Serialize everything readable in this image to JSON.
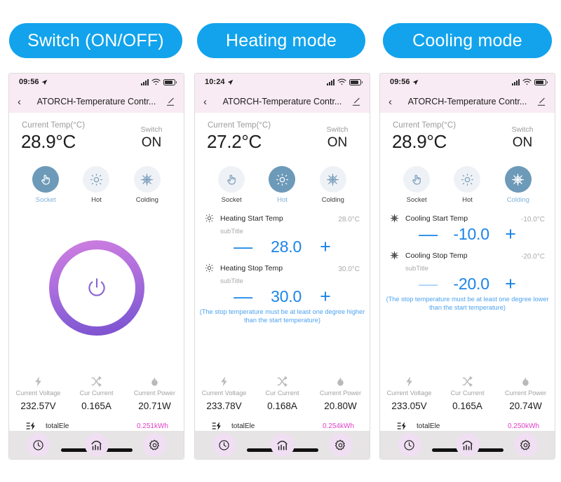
{
  "banners": [
    {
      "label": "Switch (ON/OFF)"
    },
    {
      "label": "Heating mode"
    },
    {
      "label": "Cooling mode"
    }
  ],
  "colors": {
    "banner_blue": "#12a3ec",
    "header_pink": "#f9ebf3",
    "accent_blue": "#1a84e8",
    "hint_blue": "#4da2ef",
    "total_magenta": "#e040c8",
    "mode_active": "#6d9ab8",
    "mode_inactive": "#eef2f6",
    "tabbar_bg": "#e6e4e4",
    "tab_circle": "#f0dff2"
  },
  "panels": [
    {
      "status": {
        "time": "09:56",
        "signal_icon": "signal-bars-icon",
        "wifi_icon": "wifi-icon",
        "battery_icon": "battery-icon"
      },
      "nav": {
        "back_icon": "back-chevron-icon",
        "title": "ATORCH-Temperature Contr...",
        "edit_icon": "edit-pencil-icon"
      },
      "temp": {
        "label": "Current Temp(°C)",
        "value": "28.9°C"
      },
      "switch": {
        "label": "Switch",
        "value": "ON"
      },
      "modes": [
        {
          "label": "Socket",
          "icon": "hand-tap-icon",
          "active": true
        },
        {
          "label": "Hot",
          "icon": "sun-icon",
          "active": false
        },
        {
          "label": "Colding",
          "icon": "snowflake-icon",
          "active": false
        }
      ],
      "view": "power",
      "power": {
        "icon": "power-button-icon"
      },
      "metrics": [
        {
          "icon": "lightning-bolt-icon",
          "label": "Current Voltage",
          "value": "232.57V"
        },
        {
          "icon": "shuffle-arrows-icon",
          "label": "Cur Current",
          "value": "0.165A"
        },
        {
          "icon": "flame-icon",
          "label": "Current Power",
          "value": "20.71W"
        }
      ],
      "total": {
        "icon": "energy-meter-icon",
        "label": "totalEle",
        "value": "0.251kWh"
      },
      "tabs": [
        {
          "icon": "clock-icon",
          "name": "history-tab"
        },
        {
          "icon": "bar-chart-icon",
          "name": "statistics-tab"
        },
        {
          "icon": "gear-icon",
          "name": "settings-tab"
        }
      ]
    },
    {
      "status": {
        "time": "10:24",
        "signal_icon": "signal-bars-icon",
        "wifi_icon": "wifi-icon",
        "battery_icon": "battery-icon"
      },
      "nav": {
        "back_icon": "back-chevron-icon",
        "title": "ATORCH-Temperature Contr...",
        "edit_icon": "edit-pencil-icon"
      },
      "temp": {
        "label": "Current Temp(°C)",
        "value": "27.2°C"
      },
      "switch": {
        "label": "Switch",
        "value": "ON"
      },
      "modes": [
        {
          "label": "Socket",
          "icon": "hand-tap-icon",
          "active": false
        },
        {
          "label": "Hot",
          "icon": "sun-icon",
          "active": true
        },
        {
          "label": "Colding",
          "icon": "snowflake-icon",
          "active": false
        }
      ],
      "view": "settings",
      "settings": [
        {
          "icon": "sun-icon",
          "title": "Heating Start Temp",
          "subtitle": "subTitle",
          "right_value": "28.0°C",
          "minus_label": "—",
          "minus_disabled": false,
          "value": "28.0",
          "plus_label": "+"
        },
        {
          "icon": "sun-icon",
          "title": "Heating Stop Temp",
          "subtitle": "subTitle",
          "right_value": "30.0°C",
          "minus_label": "—",
          "minus_disabled": false,
          "value": "30.0",
          "plus_label": "+"
        }
      ],
      "hint": "(The stop temperature must be at least one degree higher than the start temperature)",
      "metrics": [
        {
          "icon": "lightning-bolt-icon",
          "label": "Current Voltage",
          "value": "233.78V"
        },
        {
          "icon": "shuffle-arrows-icon",
          "label": "Cur Current",
          "value": "0.168A"
        },
        {
          "icon": "flame-icon",
          "label": "Current Power",
          "value": "20.80W"
        }
      ],
      "total": {
        "icon": "energy-meter-icon",
        "label": "totalEle",
        "value": "0.254kWh"
      },
      "tabs": [
        {
          "icon": "clock-icon",
          "name": "history-tab"
        },
        {
          "icon": "bar-chart-icon",
          "name": "statistics-tab"
        },
        {
          "icon": "gear-icon",
          "name": "settings-tab"
        }
      ]
    },
    {
      "status": {
        "time": "09:56",
        "signal_icon": "signal-bars-icon",
        "wifi_icon": "wifi-icon",
        "battery_icon": "battery-icon"
      },
      "nav": {
        "back_icon": "back-chevron-icon",
        "title": "ATORCH-Temperature Contr...",
        "edit_icon": "edit-pencil-icon"
      },
      "temp": {
        "label": "Current Temp(°C)",
        "value": "28.9°C"
      },
      "switch": {
        "label": "Switch",
        "value": "ON"
      },
      "modes": [
        {
          "label": "Socket",
          "icon": "hand-tap-icon",
          "active": false
        },
        {
          "label": "Hot",
          "icon": "sun-icon",
          "active": false
        },
        {
          "label": "Colding",
          "icon": "snowflake-icon",
          "active": true
        }
      ],
      "view": "settings",
      "settings": [
        {
          "icon": "snowflake-icon",
          "title": "Cooling Start Temp",
          "subtitle": "",
          "right_value": "-10.0°C",
          "minus_label": "—",
          "minus_disabled": false,
          "value": "-10.0",
          "plus_label": "+"
        },
        {
          "icon": "snowflake-icon",
          "title": "Cooling Stop Temp",
          "subtitle": "subTitle",
          "right_value": "-20.0°C",
          "minus_label": "—",
          "minus_disabled": true,
          "value": "-20.0",
          "plus_label": "+"
        }
      ],
      "hint": "(The stop temperature must be at least one degree lower than the start temperature)",
      "metrics": [
        {
          "icon": "lightning-bolt-icon",
          "label": "Current Voltage",
          "value": "233.05V"
        },
        {
          "icon": "shuffle-arrows-icon",
          "label": "Cur Current",
          "value": "0.165A"
        },
        {
          "icon": "flame-icon",
          "label": "Current Power",
          "value": "20.74W"
        }
      ],
      "total": {
        "icon": "energy-meter-icon",
        "label": "totalEle",
        "value": "0.250kWh"
      },
      "tabs": [
        {
          "icon": "clock-icon",
          "name": "history-tab"
        },
        {
          "icon": "bar-chart-icon",
          "name": "statistics-tab"
        },
        {
          "icon": "gear-icon",
          "name": "settings-tab"
        }
      ]
    }
  ]
}
